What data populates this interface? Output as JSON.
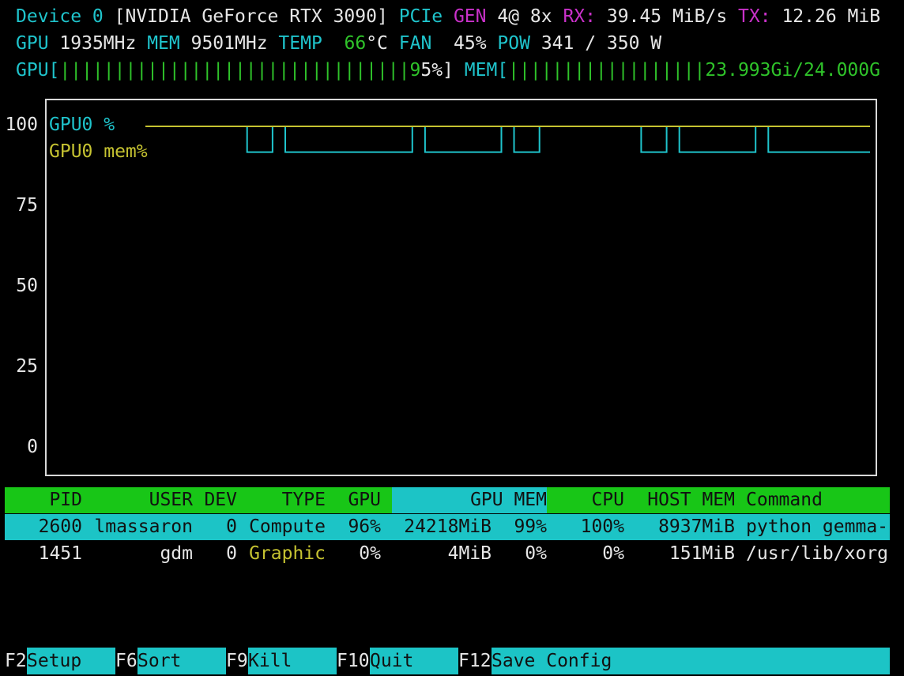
{
  "header": {
    "device_label": "Device 0",
    "device_name": "[NVIDIA GeForce RTX 3090]",
    "pcie_label": "PCIe",
    "gen_label": "GEN",
    "gen_value": "4@ 8x",
    "rx_label": "RX:",
    "rx_value": "39.45 MiB/s",
    "tx_label": "TX:",
    "tx_value": "12.26 MiB",
    "gpu_label": "GPU",
    "gpu_clock": "1935MHz",
    "mem_label": "MEM",
    "mem_clock": "9501MHz",
    "temp_label": "TEMP",
    "temp_value": "66",
    "temp_unit": "°C",
    "fan_label": "FAN",
    "fan_value": "45%",
    "pow_label": "POW",
    "pow_value": "341 / 350 W",
    "gpu_bar_label": "GPU[",
    "gpu_bar_fill": "||||||||||||||||||||||||||||||||9",
    "gpu_bar_value": "5%]",
    "gpu_util_percent": 95,
    "mem_bar_label": "MEM[",
    "mem_bar_fill": "||||||||||||||||||",
    "mem_bar_value": "23.993Gi/24.000G",
    "mem_used_gib": 23.993,
    "mem_total_gib": 24.0
  },
  "chart": {
    "yticks": [
      "100",
      "75",
      "50",
      "25",
      "0"
    ],
    "legend": [
      {
        "text": "GPU0 %",
        "color": "#1fc4cc"
      },
      {
        "text": "GPU0 mem%",
        "color": "#c6c331"
      }
    ]
  },
  "chart_data": {
    "type": "line",
    "ylim": [
      0,
      100
    ],
    "series": [
      {
        "name": "GPU0 %",
        "color": "#1fc4cc",
        "values": [
          100,
          100,
          100,
          100,
          100,
          100,
          100,
          100,
          92,
          92,
          100,
          92,
          92,
          92,
          92,
          92,
          92,
          92,
          92,
          92,
          92,
          100,
          92,
          92,
          92,
          92,
          92,
          92,
          100,
          92,
          92,
          100,
          100,
          100,
          100,
          100,
          100,
          100,
          100,
          92,
          92,
          100,
          92,
          92,
          92,
          92,
          92,
          92,
          100,
          92,
          92,
          92,
          92,
          92,
          92,
          92,
          92
        ]
      },
      {
        "name": "GPU0 mem%",
        "color": "#c6c331",
        "values": [
          100,
          100,
          100,
          100,
          100,
          100,
          100,
          100,
          100,
          100,
          100,
          100,
          100,
          100,
          100,
          100,
          100,
          100,
          100,
          100,
          100,
          100,
          100,
          100,
          100,
          100,
          100,
          100,
          100,
          100,
          100,
          100,
          100,
          100,
          100,
          100,
          100,
          100,
          100,
          100,
          100,
          100,
          100,
          100,
          100,
          100,
          100,
          100,
          100,
          100,
          100,
          100,
          100,
          100,
          100,
          100,
          100
        ]
      }
    ]
  },
  "table": {
    "headers": [
      "PID",
      "USER",
      "DEV",
      "TYPE",
      "GPU",
      "GPU MEM",
      "CPU",
      "HOST MEM",
      "Command"
    ],
    "rows": [
      [
        "2600",
        "lmassaron",
        "0",
        "Compute",
        "96%",
        "24218MiB",
        "99%",
        "100%",
        "8937MiB",
        "python gemma-"
      ],
      [
        "1451",
        "gdm",
        "0",
        "Graphic",
        "0%",
        "4MiB",
        "0%",
        "0%",
        "151MiB",
        "/usr/lib/xorg"
      ]
    ]
  },
  "footer": [
    {
      "key": "F2",
      "label": "Setup"
    },
    {
      "key": "F6",
      "label": "Sort"
    },
    {
      "key": "F9",
      "label": "Kill"
    },
    {
      "key": "F10",
      "label": "Quit"
    },
    {
      "key": "F12",
      "label": "Save Config"
    }
  ]
}
